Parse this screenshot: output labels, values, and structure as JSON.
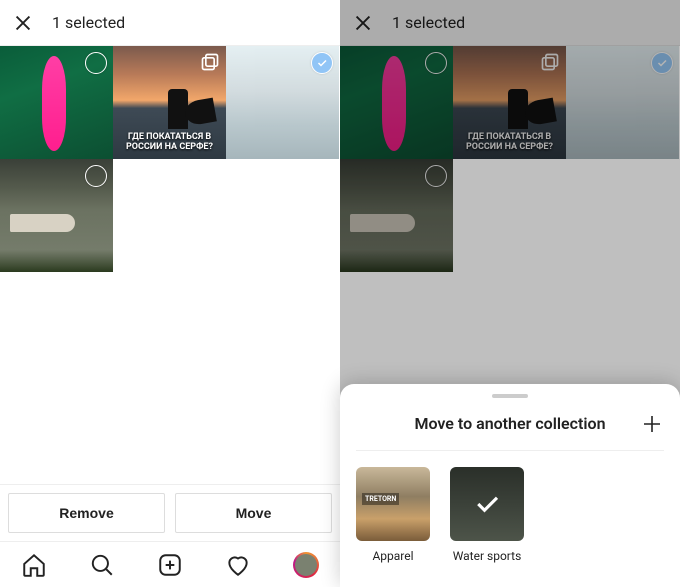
{
  "left": {
    "header_title": "1 selected",
    "thumbs": {
      "surf_caption": "ГДЕ ПОКАТАТЬСЯ В РОССИИ НА СЕРФЕ?"
    },
    "actions": {
      "remove": "Remove",
      "move": "Move"
    }
  },
  "right": {
    "header_title": "1 selected",
    "thumbs": {
      "surf_caption": "ГДЕ ПОКАТАТЬСЯ В РОССИИ НА СЕРФЕ?"
    },
    "sheet": {
      "title": "Move to another collection",
      "collections": [
        {
          "label": "Apparel"
        },
        {
          "label": "Water sports"
        }
      ]
    }
  },
  "icons": {
    "close": "close-icon",
    "home": "home-icon",
    "search": "search-icon",
    "add": "add-post-icon",
    "heart": "heart-icon",
    "profile": "profile-avatar",
    "plus": "plus-icon",
    "multi": "multi-photo-icon",
    "check": "checkmark-icon"
  }
}
